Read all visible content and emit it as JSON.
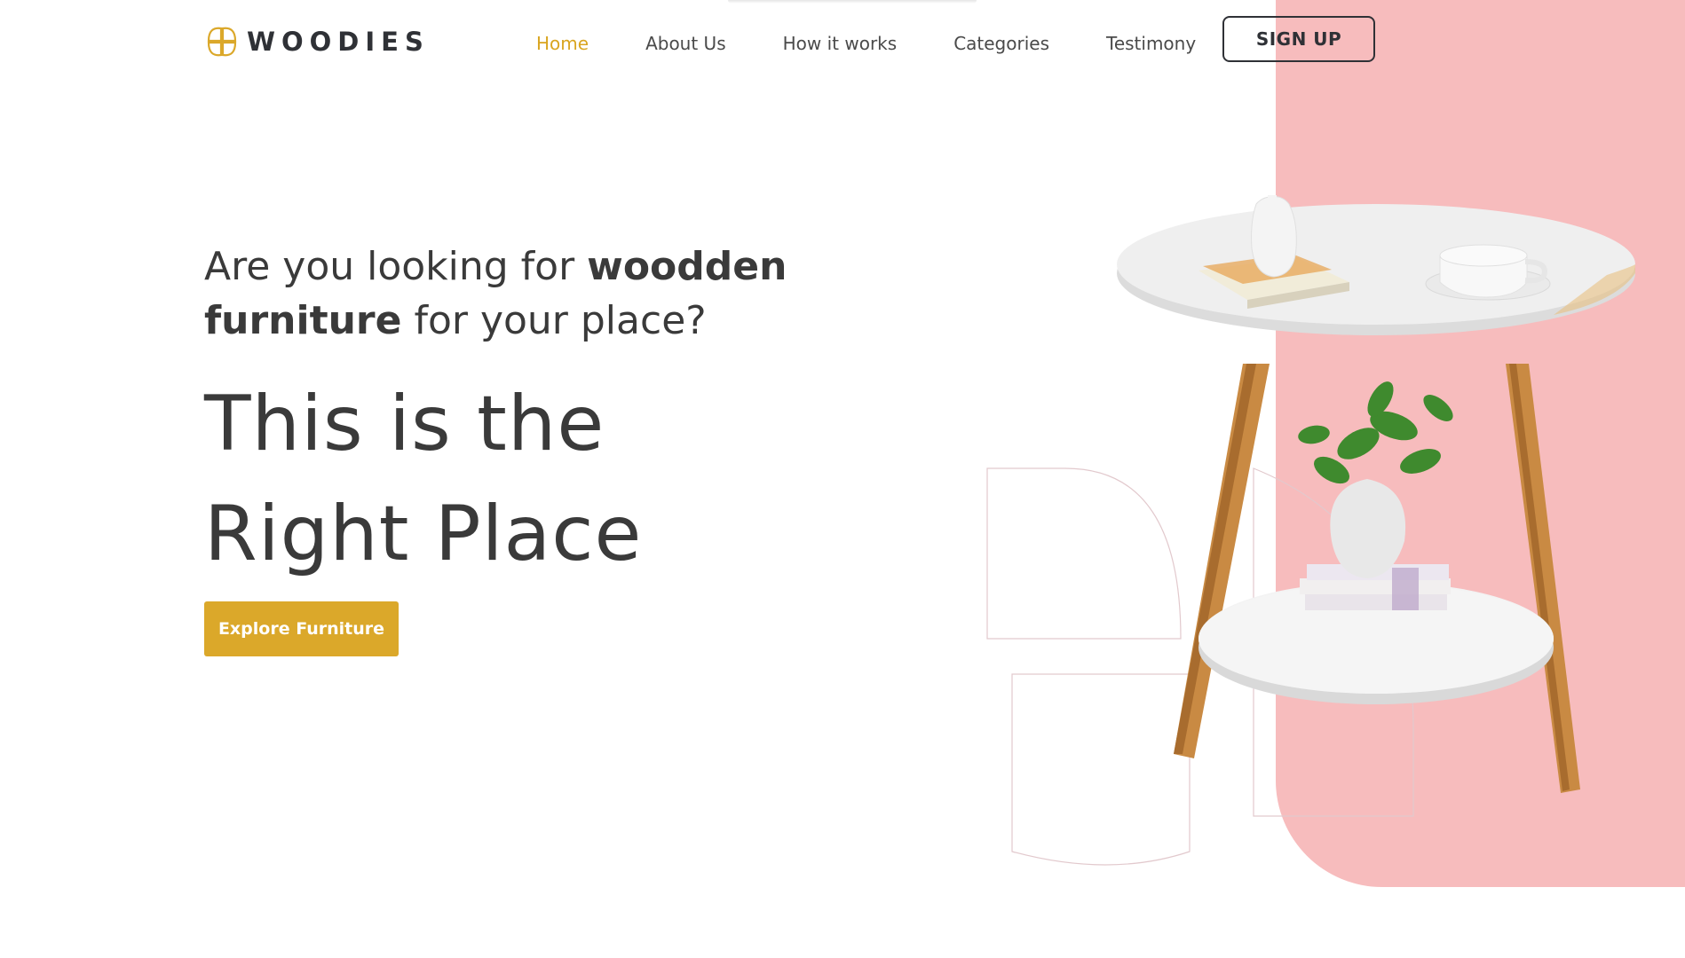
{
  "brand": {
    "name": "WOODIES",
    "accent": "#dba82a",
    "panel_color": "#f7bcbd"
  },
  "nav": {
    "items": [
      {
        "label": "Home",
        "active": true
      },
      {
        "label": "About Us",
        "active": false
      },
      {
        "label": "How it works",
        "active": false
      },
      {
        "label": "Categories",
        "active": false
      },
      {
        "label": "Testimony",
        "active": false
      }
    ],
    "signup_label": "SIGN UP"
  },
  "hero": {
    "line_a": "Are you looking for ",
    "line_a_bold": "woodden",
    "line_b_bold": "furniture",
    "line_b": " for your place?",
    "headline_1": "This is the",
    "headline_2": "Right Place",
    "cta_label": "Explore Furniture"
  },
  "image": {
    "alt": "Round white two-tier side table with wooden legs, vase, books, cup and plant"
  }
}
